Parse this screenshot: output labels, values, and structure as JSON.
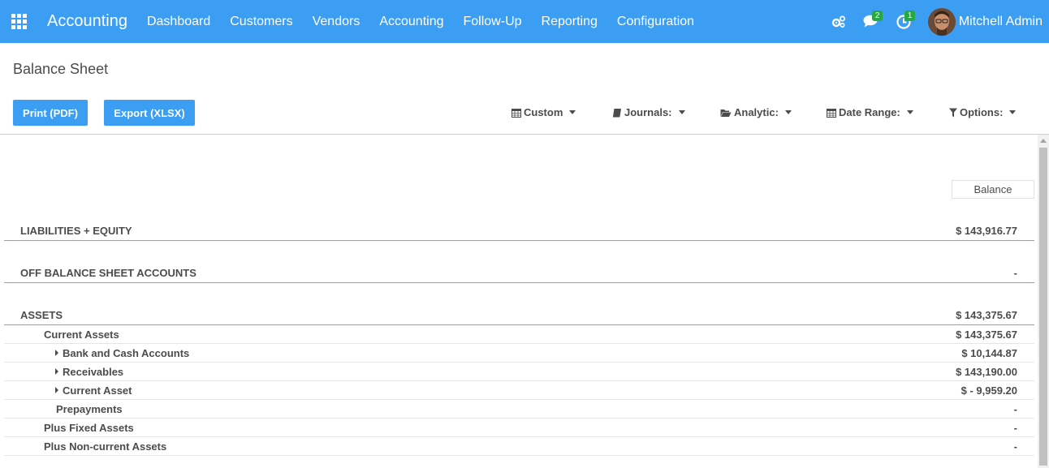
{
  "navbar": {
    "brand": "Accounting",
    "menu": [
      "Dashboard",
      "Customers",
      "Vendors",
      "Accounting",
      "Follow-Up",
      "Reporting",
      "Configuration"
    ],
    "icons": [
      "apps-icon",
      "gears-icon",
      "chat-icon",
      "clock-icon"
    ],
    "chat_badge": "2",
    "activity_badge": "1",
    "user_name": "Mitchell Admin",
    "color": "#3c9ef3"
  },
  "page": {
    "title": "Balance Sheet",
    "print_label": "Print (PDF)",
    "export_label": "Export (XLSX)"
  },
  "filters": {
    "custom": "Custom",
    "journals": "Journals:",
    "analytic": "Analytic:",
    "date_range": "Date Range:",
    "options": "Options:"
  },
  "report": {
    "column_header": "Balance",
    "rows": [
      {
        "label": "LIABILITIES + EQUITY",
        "value": "$ 143,916.77"
      },
      {
        "label": "OFF BALANCE SHEET ACCOUNTS",
        "value": "-"
      },
      {
        "label": "ASSETS",
        "value": "$ 143,375.67"
      },
      {
        "label": "Current Assets",
        "value": "$ 143,375.67"
      },
      {
        "label": "Bank and Cash Accounts",
        "value": "$ 10,144.87"
      },
      {
        "label": "Receivables",
        "value": "$ 143,190.00"
      },
      {
        "label": "Current Asset",
        "value": "$ - 9,959.20"
      },
      {
        "label": "Prepayments",
        "value": "-"
      },
      {
        "label": "Plus Fixed Assets",
        "value": "-"
      },
      {
        "label": "Plus Non-current Assets",
        "value": "-"
      }
    ]
  }
}
